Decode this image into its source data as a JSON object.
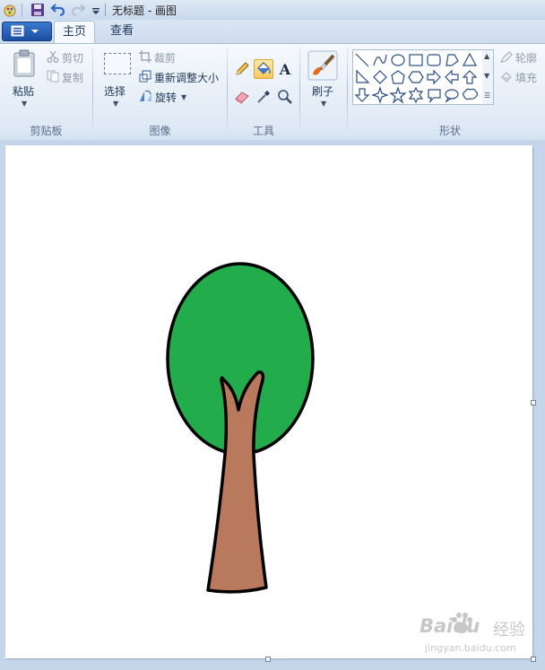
{
  "window": {
    "title": "无标题 - 画图"
  },
  "tabs": {
    "home": "主页",
    "view": "查看"
  },
  "clipboard": {
    "paste": "粘贴",
    "cut": "剪切",
    "copy": "复制",
    "group": "剪贴板"
  },
  "image": {
    "select": "选择",
    "crop": "裁剪",
    "resize": "重新调整大小",
    "rotate": "旋转",
    "group": "图像"
  },
  "tools": {
    "group": "工具",
    "selected": "fill"
  },
  "brushes": {
    "label": "刷子"
  },
  "shapes": {
    "outline": "轮廓",
    "fill": "填充",
    "group": "形状"
  },
  "colors": {
    "tree_crown": "#23ac4b",
    "tree_trunk": "#b9795c",
    "outline": "#000000"
  },
  "watermark": {
    "brand": "Baidu",
    "cn": "经验",
    "url": "jingyan.baidu.com"
  }
}
